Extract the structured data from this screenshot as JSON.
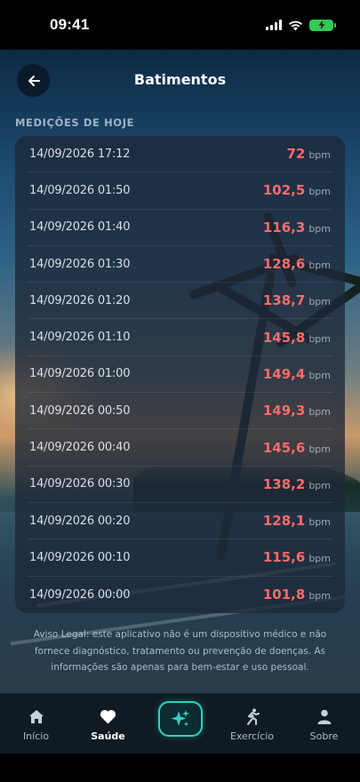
{
  "status_bar": {
    "time": "09:41"
  },
  "header": {
    "title": "Batimentos",
    "back_icon": "arrow-left-icon"
  },
  "section_label": "MEDIÇÕES DE HOJE",
  "unit": "bpm",
  "measurements": [
    {
      "datetime": "14/09/2026 17:12",
      "value": "72"
    },
    {
      "datetime": "14/09/2026 01:50",
      "value": "102,5"
    },
    {
      "datetime": "14/09/2026 01:40",
      "value": "116,3"
    },
    {
      "datetime": "14/09/2026 01:30",
      "value": "128,6"
    },
    {
      "datetime": "14/09/2026 01:20",
      "value": "138,7"
    },
    {
      "datetime": "14/09/2026 01:10",
      "value": "145,8"
    },
    {
      "datetime": "14/09/2026 01:00",
      "value": "149,4"
    },
    {
      "datetime": "14/09/2026 00:50",
      "value": "149,3"
    },
    {
      "datetime": "14/09/2026 00:40",
      "value": "145,6"
    },
    {
      "datetime": "14/09/2026 00:30",
      "value": "138,2"
    },
    {
      "datetime": "14/09/2026 00:20",
      "value": "128,1"
    },
    {
      "datetime": "14/09/2026 00:10",
      "value": "115,6"
    },
    {
      "datetime": "14/09/2026 00:00",
      "value": "101,8"
    }
  ],
  "disclaimer": "Aviso Legal: este aplicativo não é um dispositivo médico e não fornece diagnóstico, tratamento ou prevenção de doenças. As informações são apenas para bem-estar e uso pessoal.",
  "nav": {
    "items": [
      {
        "label": "Início",
        "icon": "home-icon"
      },
      {
        "label": "Saúde",
        "icon": "heart-icon",
        "active": true
      },
      {
        "label": "",
        "icon": "sparkles-icon"
      },
      {
        "label": "Exercício",
        "icon": "running-icon"
      },
      {
        "label": "Sobre",
        "icon": "person-icon"
      }
    ]
  },
  "colors": {
    "value_red": "#ff6b6b",
    "accent_teal": "#2fd3c0",
    "battery_green": "#34c759"
  }
}
